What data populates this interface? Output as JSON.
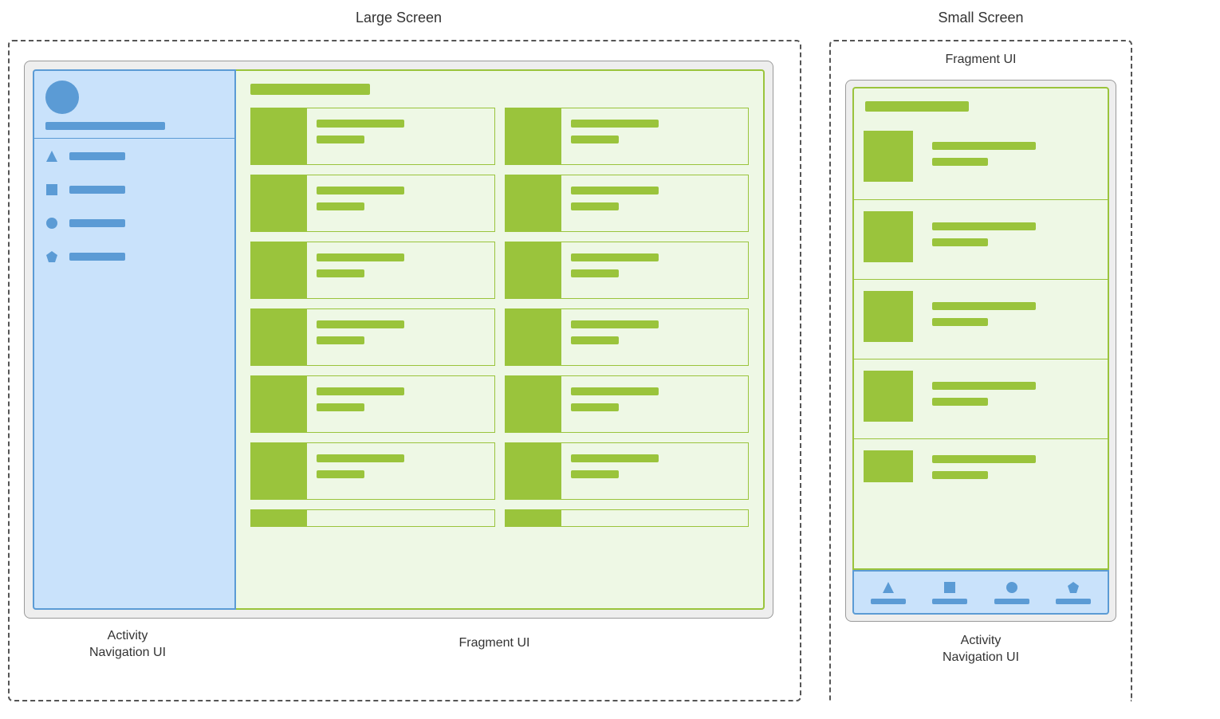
{
  "titles": {
    "large": "Large Screen",
    "small": "Small Screen"
  },
  "labels": {
    "activity": "Activity",
    "navigation_ui": "Navigation UI",
    "fragment_ui": "Fragment UI"
  },
  "nav_icons": [
    "triangle",
    "square",
    "circle",
    "pentagon"
  ],
  "colors": {
    "nav_bg": "#c9e2fb",
    "nav_accent": "#5b9bd5",
    "fragment_bg": "#eef8e5",
    "fragment_accent": "#9ac43c",
    "device_bg": "#eeeeee",
    "device_border": "#9a9a9a"
  },
  "large_screen": {
    "card_rows_visible": 6,
    "card_columns": 2,
    "partial_row_visible": true
  },
  "small_screen": {
    "cards_visible": 4,
    "partial_card_visible": true
  }
}
